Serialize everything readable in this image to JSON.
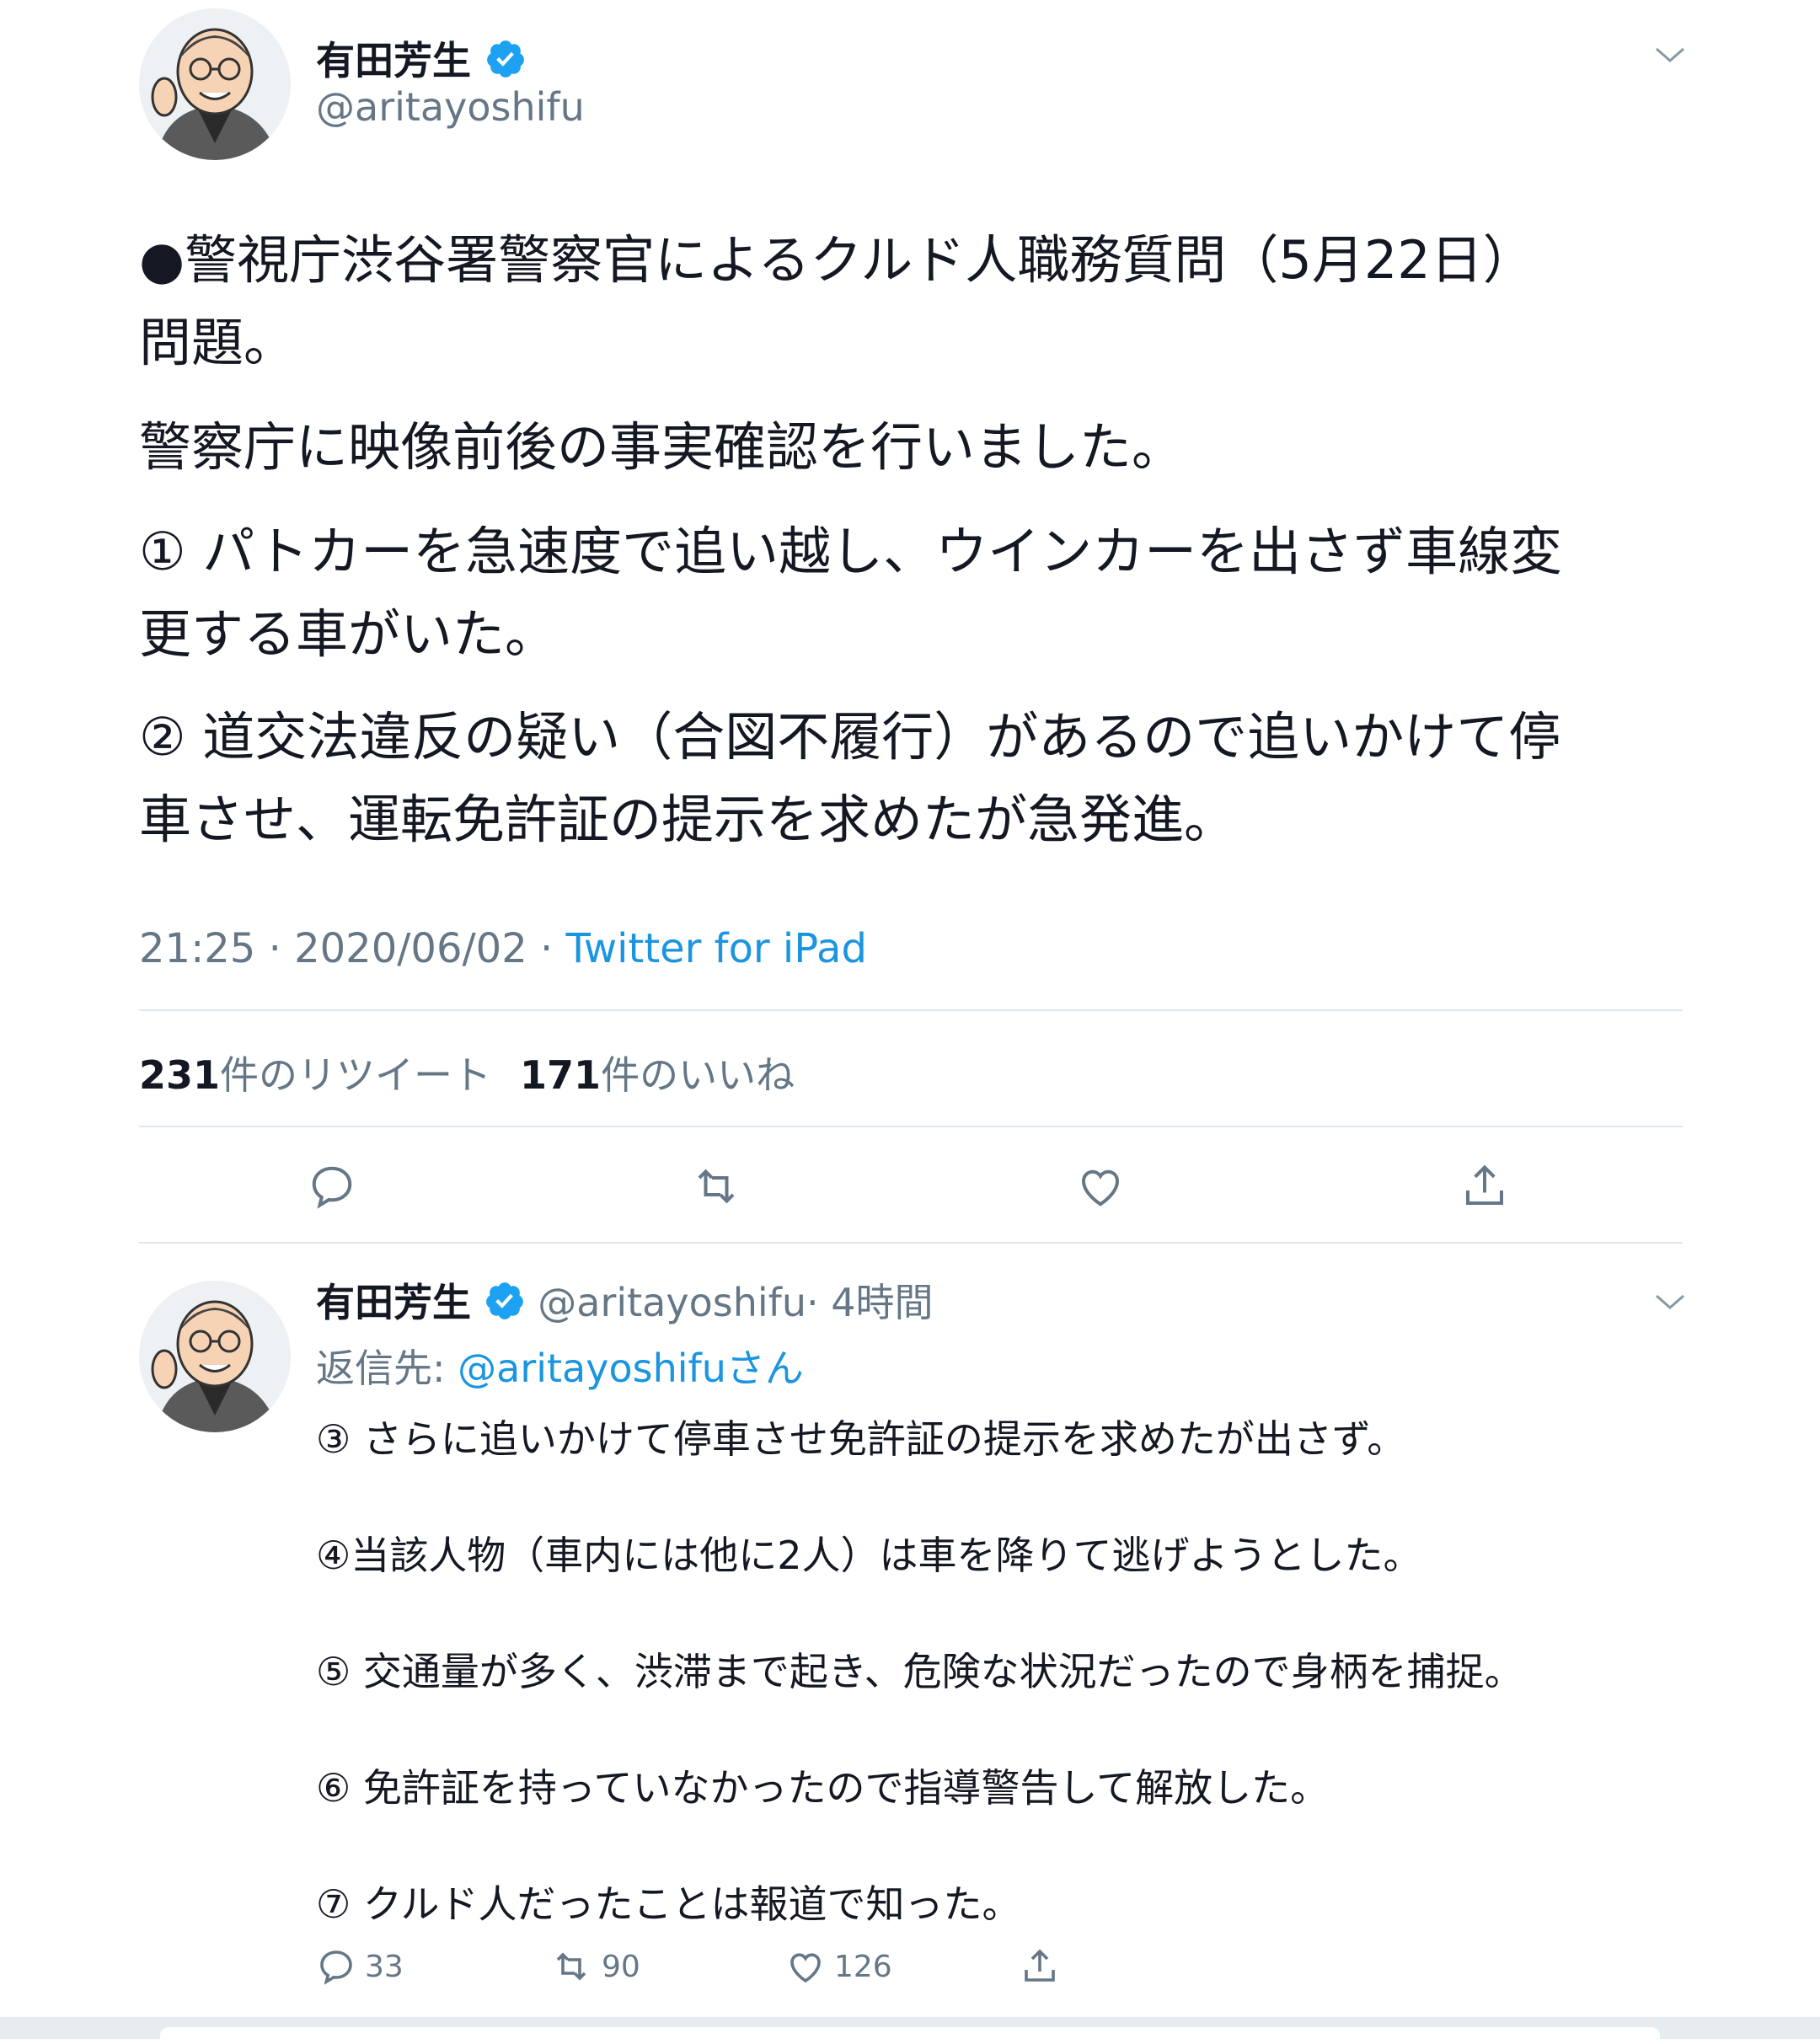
{
  "main_tweet": {
    "author_name": "有田芳生",
    "author_handle": "@aritayoshifu",
    "body": {
      "line1": "●警視庁渋谷署警察官によるクルド人職務質問（5月22日）",
      "line2": "問題。",
      "line3": "警察庁に映像前後の事実確認を行いました。",
      "line4": "① パトカーを急速度で追い越し、ウインカーを出さず車線変",
      "line5": "更する車がいた。",
      "line6": "② 道交法違反の疑い（合図不履行）があるので追いかけて停",
      "line7": "車させ、運転免許証の提示を求めたが急発進。"
    },
    "time": "21:25 · 2020/06/02 · ",
    "source": "Twitter for iPad",
    "retweets_count": "231",
    "retweets_label": "件のリツイート",
    "likes_count": "171",
    "likes_label": "件のいいね"
  },
  "reply_tweet": {
    "author_name": "有田芳生",
    "author_handle": "@aritayoshifu",
    "time_ago": "· 4時間",
    "reply_prefix": "返信先: ",
    "reply_target": "@aritayoshifuさん",
    "lines": [
      "③ さらに追いかけて停車させ免許証の提示を求めたが出さず。",
      "④当該人物（車内には他に2人）は車を降りて逃げようとした。",
      "⑤ 交通量が多く、渋滞まで起き、危険な状況だったので身柄を捕捉。",
      "⑥ 免許証を持っていなかったので指導警告して解放した。",
      "⑦ クルド人だったことは報道で知った。"
    ],
    "reply_count": "33",
    "retweet_count": "90",
    "like_count": "126"
  },
  "icons": {
    "verified": "verified-badge-icon",
    "chevron": "chevron-down-icon",
    "reply": "reply-icon",
    "retweet": "retweet-icon",
    "like": "heart-icon",
    "share": "share-icon"
  },
  "colors": {
    "accent": "#1b95e0",
    "verified": "#1da1f2",
    "muted": "#657786",
    "text": "#141823",
    "divider": "#e1e8ed"
  }
}
